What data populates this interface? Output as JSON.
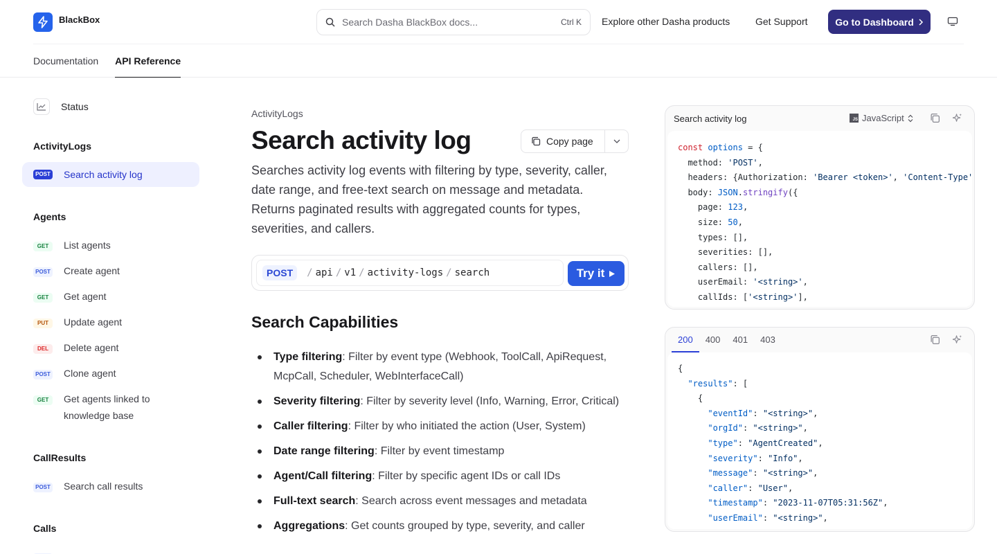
{
  "header": {
    "brand": "BlackBox",
    "search_placeholder": "Search Dasha BlackBox docs...",
    "search_shortcut": "Ctrl K",
    "explore_link": "Explore other Dasha products",
    "support_link": "Get Support",
    "dashboard_button": "Go to Dashboard",
    "tabs": [
      {
        "label": "Documentation",
        "active": false
      },
      {
        "label": "API Reference",
        "active": true
      }
    ]
  },
  "sidebar": {
    "status": "Status",
    "groups": [
      {
        "title": "ActivityLogs",
        "items": [
          {
            "method": "POST",
            "label": "Search activity log",
            "active": true
          }
        ]
      },
      {
        "title": "Agents",
        "items": [
          {
            "method": "GET",
            "label": "List agents"
          },
          {
            "method": "POST",
            "label": "Create agent"
          },
          {
            "method": "GET",
            "label": "Get agent"
          },
          {
            "method": "PUT",
            "label": "Update agent"
          },
          {
            "method": "DEL",
            "label": "Delete agent"
          },
          {
            "method": "POST",
            "label": "Clone agent"
          },
          {
            "method": "GET",
            "label": "Get agents linked to knowledge base"
          }
        ]
      },
      {
        "title": "CallResults",
        "items": [
          {
            "method": "POST",
            "label": "Search call results"
          }
        ]
      },
      {
        "title": "Calls",
        "items": []
      }
    ]
  },
  "main": {
    "breadcrumb": "ActivityLogs",
    "title": "Search activity log",
    "copy_page": "Copy page",
    "description": "Searches activity log events with filtering by type, severity, caller, date range, and free-text search on message and metadata. Returns paginated results with aggregated counts for types, severities, and callers.",
    "endpoint": {
      "method": "POST",
      "segments": [
        "api",
        "v1",
        "activity-logs",
        "search"
      ],
      "try_label": "Try it"
    },
    "section_title": "Search Capabilities",
    "capabilities": [
      {
        "term": "Type filtering",
        "text": ": Filter by event type (Webhook, ToolCall, ApiRequest, McpCall, Scheduler, WebInterfaceCall)"
      },
      {
        "term": "Severity filtering",
        "text": ": Filter by severity level (Info, Warning, Error, Critical)"
      },
      {
        "term": "Caller filtering",
        "text": ": Filter by who initiated the action (User, System)"
      },
      {
        "term": "Date range filtering",
        "text": ": Filter by event timestamp"
      },
      {
        "term": "Agent/Call filtering",
        "text": ": Filter by specific agent IDs or call IDs"
      },
      {
        "term": "Full-text search",
        "text": ": Search across event messages and metadata"
      },
      {
        "term": "Aggregations",
        "text": ": Get counts grouped by type, severity, and caller"
      }
    ]
  },
  "request_panel": {
    "title": "Search activity log",
    "language": "JavaScript",
    "code": {
      "l1_kw": "const",
      "l1_var": "options",
      "method_val": "'POST'",
      "auth_val": "'Bearer <token>'",
      "ctype_key": "'Content-Type'",
      "json_obj": "JSON",
      "stringify": "stringify",
      "page": "123",
      "size": "50",
      "user_email": "'<string>'",
      "call_ids": "'<string>'"
    }
  },
  "response_panel": {
    "tabs": [
      "200",
      "400",
      "401",
      "403"
    ],
    "active_tab": "200",
    "fields": [
      {
        "key": "\"eventId\"",
        "value": "\"<string>\""
      },
      {
        "key": "\"orgId\"",
        "value": "\"<string>\""
      },
      {
        "key": "\"type\"",
        "value": "\"AgentCreated\""
      },
      {
        "key": "\"severity\"",
        "value": "\"Info\""
      },
      {
        "key": "\"message\"",
        "value": "\"<string>\""
      },
      {
        "key": "\"caller\"",
        "value": "\"User\""
      },
      {
        "key": "\"timestamp\"",
        "value": "\"2023-11-07T05:31:56Z\""
      },
      {
        "key": "\"userEmail\"",
        "value": "\"<string>\""
      }
    ],
    "results_key": "\"results\""
  },
  "colors": {
    "accent": "#2b5be0",
    "dashboard_button": "#312e81",
    "active_sidebar_bg": "#eef0ff"
  }
}
